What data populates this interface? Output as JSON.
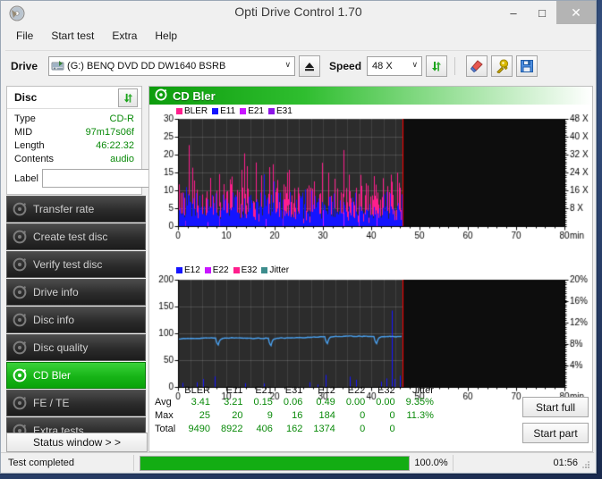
{
  "window": {
    "title": "Opti Drive Control 1.70",
    "icon": "disc-icon",
    "minimize": "–",
    "maximize": "□",
    "close": "✕"
  },
  "menu": {
    "items": [
      {
        "label": "File"
      },
      {
        "label": "Start test"
      },
      {
        "label": "Extra"
      },
      {
        "label": "Help"
      }
    ]
  },
  "toolbar": {
    "drive_label": "Drive",
    "drive_value": "(G:)   BENQ DVD DD DW1640 BSRB",
    "drive_arrow": "∨",
    "eject_icon": "eject-icon",
    "speed_label": "Speed",
    "speed_value": "48 X",
    "speed_arrow": "∨",
    "refresh_icon": "refresh-icon",
    "erase_icon": "erase-icon",
    "tools_icon": "tools-icon",
    "save_icon": "save-icon"
  },
  "disc": {
    "header": "Disc",
    "refresh_icon": "refresh-icon",
    "rows": [
      {
        "key": "Type",
        "value": "CD-R"
      },
      {
        "key": "MID",
        "value": "97m17s06f"
      },
      {
        "key": "Length",
        "value": "46:22.32"
      },
      {
        "key": "Contents",
        "value": "audio"
      }
    ],
    "label_key": "Label",
    "label_value": "",
    "label_placeholder": "",
    "cd_icon": "cd-icon"
  },
  "sidebar": {
    "items": [
      {
        "label": "Transfer rate",
        "icon": "disc-icon",
        "active": false
      },
      {
        "label": "Create test disc",
        "icon": "disc-icon",
        "active": false
      },
      {
        "label": "Verify test disc",
        "icon": "disc-icon",
        "active": false
      },
      {
        "label": "Drive info",
        "icon": "disc-icon",
        "active": false
      },
      {
        "label": "Disc info",
        "icon": "disc-icon",
        "active": false
      },
      {
        "label": "Disc quality",
        "icon": "disc-icon",
        "active": false
      },
      {
        "label": "CD Bler",
        "icon": "disc-icon",
        "active": true
      },
      {
        "label": "FE / TE",
        "icon": "disc-icon",
        "active": false
      },
      {
        "label": "Extra tests",
        "icon": "disc-icon",
        "active": false
      }
    ],
    "status_button": "Status window > >"
  },
  "main": {
    "header": "CD Bler",
    "header_icon": "disc-icon",
    "start_full": "Start full",
    "start_part": "Start part"
  },
  "stats": {
    "columns": [
      "BLER",
      "E11",
      "E21",
      "E31",
      "E12",
      "E22",
      "E32",
      "Jitter"
    ],
    "rows": [
      {
        "label": "Avg",
        "values": [
          "3.41",
          "3.21",
          "0.15",
          "0.06",
          "0.49",
          "0.00",
          "0.00",
          "9.35%"
        ]
      },
      {
        "label": "Max",
        "values": [
          "25",
          "20",
          "9",
          "16",
          "184",
          "0",
          "0",
          "11.3%"
        ]
      },
      {
        "label": "Total",
        "values": [
          "9490",
          "8922",
          "406",
          "162",
          "1374",
          "0",
          "0",
          ""
        ]
      }
    ]
  },
  "statusbar": {
    "text": "Test completed",
    "progress_label": "100.0%",
    "progress_percent": 100,
    "elapsed": "01:56"
  },
  "colors": {
    "bler": "#ff1e8c",
    "e11": "#1414ff",
    "e21": "#c814ff",
    "e31": "#8c14e6",
    "e12": "#1414ff",
    "e22": "#c814ff",
    "e32": "#ff1e8c",
    "jitter": "#3c8c8c",
    "jitter_line": "#4aa0ee",
    "speed_line": "#ff0000",
    "plot_bg": "#2c2c2c",
    "accent_green": "#13ad13",
    "value_green": "#0a8a0a"
  },
  "chart_data": [
    {
      "type": "bar",
      "title": "CD Bler",
      "xlabel": "min",
      "ylabel": "",
      "xlim": [
        0,
        80
      ],
      "ylim": [
        0,
        30
      ],
      "yticks": [
        0,
        5,
        10,
        15,
        20,
        25,
        30
      ],
      "xticks": [
        0,
        10,
        20,
        30,
        40,
        50,
        60,
        70,
        80
      ],
      "xtick_labels": [
        "0",
        "10",
        "20",
        "30",
        "40",
        "50",
        "60",
        "70",
        "80"
      ],
      "x_unit_label": "min",
      "right_axis": {
        "label": "X",
        "ticks": [
          8,
          16,
          24,
          32,
          40,
          48
        ],
        "tick_labels": [
          "8 X",
          "16 X",
          "24 X",
          "32 X",
          "40 X",
          "48 X"
        ],
        "lim": [
          0,
          48
        ]
      },
      "grid": true,
      "legend": [
        "BLER",
        "E11",
        "E21",
        "E31"
      ],
      "legend_colors": [
        "#ff1e8c",
        "#1414ff",
        "#c814ff",
        "#8c14e6"
      ],
      "legend_position": "top-left",
      "data_end_min": 46.4,
      "series": [
        {
          "name": "BLER",
          "color": "#ff1e8c",
          "avg": 3.41,
          "max": 25,
          "total": 9490
        },
        {
          "name": "E11",
          "color": "#1414ff",
          "avg": 3.21,
          "max": 20,
          "total": 8922
        },
        {
          "name": "E21",
          "color": "#c814ff",
          "avg": 0.15,
          "max": 9,
          "total": 406
        },
        {
          "name": "E31",
          "color": "#8c14e6",
          "avg": 0.06,
          "max": 16,
          "total": 162
        }
      ]
    },
    {
      "type": "line",
      "title": "",
      "xlabel": "min",
      "ylabel": "",
      "xlim": [
        0,
        80
      ],
      "ylim": [
        0,
        200
      ],
      "yticks": [
        0,
        50,
        100,
        150,
        200
      ],
      "xticks": [
        0,
        10,
        20,
        30,
        40,
        50,
        60,
        70,
        80
      ],
      "xtick_labels": [
        "0",
        "10",
        "20",
        "30",
        "40",
        "50",
        "60",
        "70",
        "80"
      ],
      "x_unit_label": "min",
      "right_axis": {
        "label": "%",
        "ticks": [
          4,
          8,
          12,
          16,
          20
        ],
        "tick_labels": [
          "4%",
          "8%",
          "12%",
          "16%",
          "20%"
        ],
        "lim": [
          0,
          20
        ]
      },
      "grid": true,
      "legend": [
        "E12",
        "E22",
        "E32",
        "Jitter"
      ],
      "legend_colors": [
        "#1414ff",
        "#c814ff",
        "#ff1e8c",
        "#3c8c8c"
      ],
      "legend_position": "top-left",
      "data_end_min": 46.4,
      "series": [
        {
          "name": "E12",
          "color": "#1414ff",
          "avg": 0.49,
          "max": 184,
          "total": 1374
        },
        {
          "name": "E22",
          "color": "#c814ff",
          "avg": 0.0,
          "max": 0,
          "total": 0
        },
        {
          "name": "E32",
          "color": "#ff1e8c",
          "avg": 0.0,
          "max": 0,
          "total": 0
        },
        {
          "name": "Jitter",
          "color": "#4aa0ee",
          "avg": 9.35,
          "max": 11.3,
          "unit": "%"
        }
      ]
    }
  ]
}
